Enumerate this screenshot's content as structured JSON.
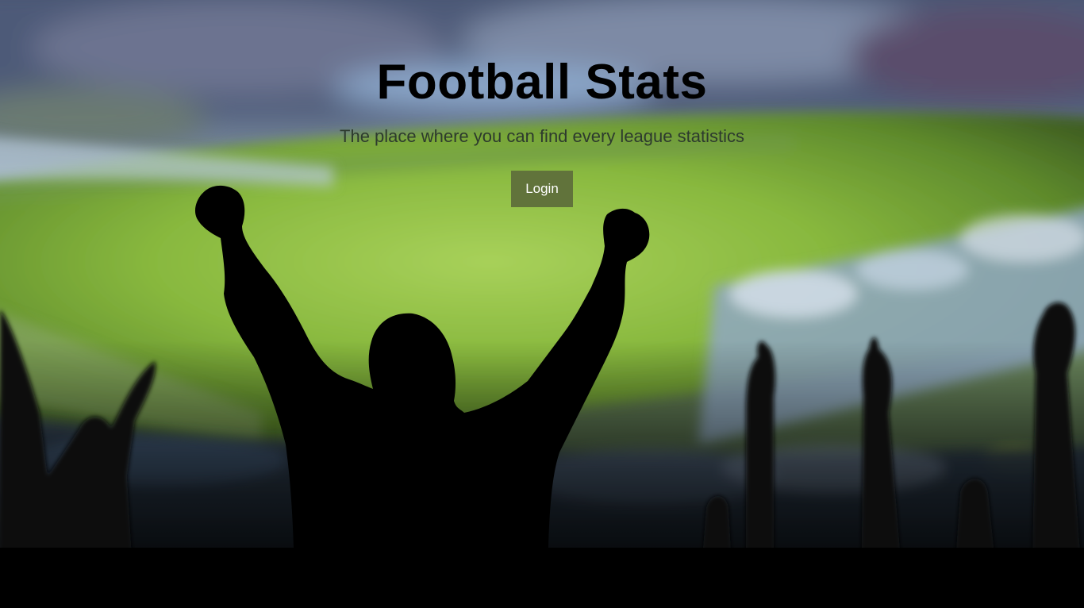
{
  "hero": {
    "title": "Football Stats",
    "subtitle": "The place where you can find every league statistics",
    "login_label": "Login"
  },
  "colors": {
    "button_bg": "#61733b",
    "button_text": "#ffffff",
    "title": "#000000",
    "subtitle": "#2d3a2e"
  },
  "background": {
    "icon": "stadium-crowd-silhouette-image"
  }
}
